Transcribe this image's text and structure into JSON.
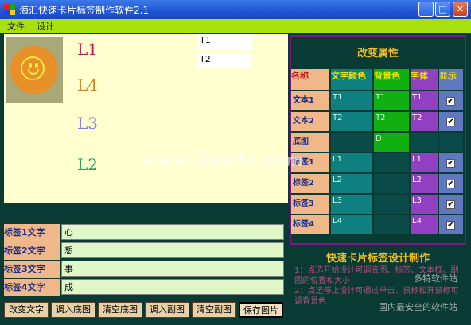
{
  "window": {
    "title": "海汇快速卡片标签制作软件2.1"
  },
  "menu": {
    "items": [
      "文件",
      "设计"
    ]
  },
  "preview": {
    "labels": [
      "L1",
      "L4",
      "L3",
      "L2"
    ],
    "label_colors": [
      "#c02050",
      "#d88020",
      "#8080e0",
      "#20a060"
    ],
    "text_boxes": [
      "T1",
      "T2"
    ]
  },
  "label_rows": [
    {
      "name": "标签1文字",
      "value": "心"
    },
    {
      "name": "标签2文字",
      "value": "想"
    },
    {
      "name": "标签3文字",
      "value": "事"
    },
    {
      "name": "标签4文字",
      "value": "成"
    }
  ],
  "buttons": [
    "改变文字",
    "调入底图",
    "清空底图",
    "调入副图",
    "清空副图",
    "保存图片"
  ],
  "props": {
    "title": "改变属性",
    "headers": [
      "名称",
      "文字颜色",
      "背景色",
      "字体",
      "显示"
    ],
    "rows": [
      {
        "name": "文本1",
        "text_color": "T1",
        "bg": "T1",
        "font": "T1",
        "visible": true
      },
      {
        "name": "文本2",
        "text_color": "T2",
        "bg": "T2",
        "font": "T2",
        "visible": true
      },
      {
        "name": "底图",
        "text_color": "",
        "bg": "D",
        "font": "",
        "visible": false
      },
      {
        "name": "标签1",
        "text_color": "L1",
        "bg": "",
        "font": "L1",
        "visible": true
      },
      {
        "name": "标签2",
        "text_color": "L2",
        "bg": "",
        "font": "L2",
        "visible": true
      },
      {
        "name": "标签3",
        "text_color": "L3",
        "bg": "",
        "font": "L3",
        "visible": true
      },
      {
        "name": "标签4",
        "text_color": "L4",
        "bg": "",
        "font": "L4",
        "visible": true
      }
    ]
  },
  "footer": {
    "title": "快速卡片标签设计制作",
    "line1": "1：点选开始设计可调底图、标签、文本框、副图的位置和大小",
    "line2": "2：点选停止设计可通过单击、鼠标松开鼠标可调背景色"
  },
  "watermark": {
    "main": "www.DuoTe.com",
    "sub1": "多特软件站",
    "sub2": "国内最安全的软件站"
  }
}
